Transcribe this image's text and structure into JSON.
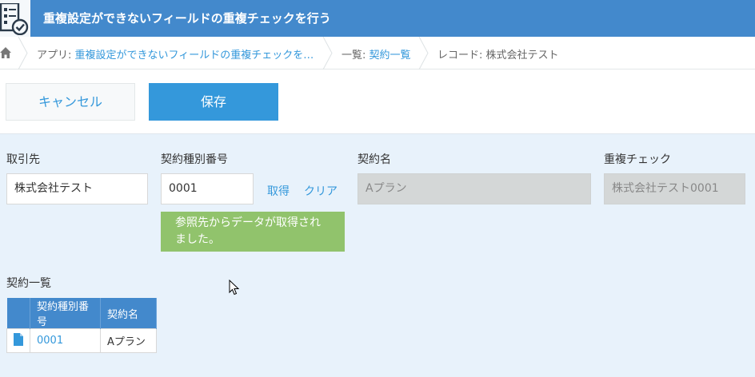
{
  "app": {
    "title": "重複設定ができないフィールドの重複チェックを行う"
  },
  "breadcrumb": {
    "app_prefix": "アプリ: ",
    "app_link": "重複設定ができないフィールドの重複チェックを…",
    "list_prefix": "一覧: ",
    "list_link": "契約一覧",
    "record": "レコード: 株式会社テスト"
  },
  "toolbar": {
    "cancel_label": "キャンセル",
    "save_label": "保存"
  },
  "form": {
    "customer": {
      "label": "取引先",
      "value": "株式会社テスト"
    },
    "contract_type_no": {
      "label": "契約種別番号",
      "value": "0001",
      "fetch_label": "取得",
      "clear_label": "クリア"
    },
    "notice": "参照先からデータが取得されました。",
    "contract_name": {
      "label": "契約名",
      "value": "Aプラン"
    },
    "duplicate_check": {
      "label": "重複チェック",
      "value": "株式会社テスト0001"
    }
  },
  "subtable": {
    "label": "契約一覧",
    "columns": [
      "契約種別番号",
      "契約名"
    ],
    "rows": [
      {
        "number": "0001",
        "name": "Aプラン"
      }
    ]
  },
  "colors": {
    "header_bg": "#4389cc",
    "accent": "#3498db",
    "notice_bg": "#91c36c",
    "page_bg": "#e8f2fb"
  }
}
